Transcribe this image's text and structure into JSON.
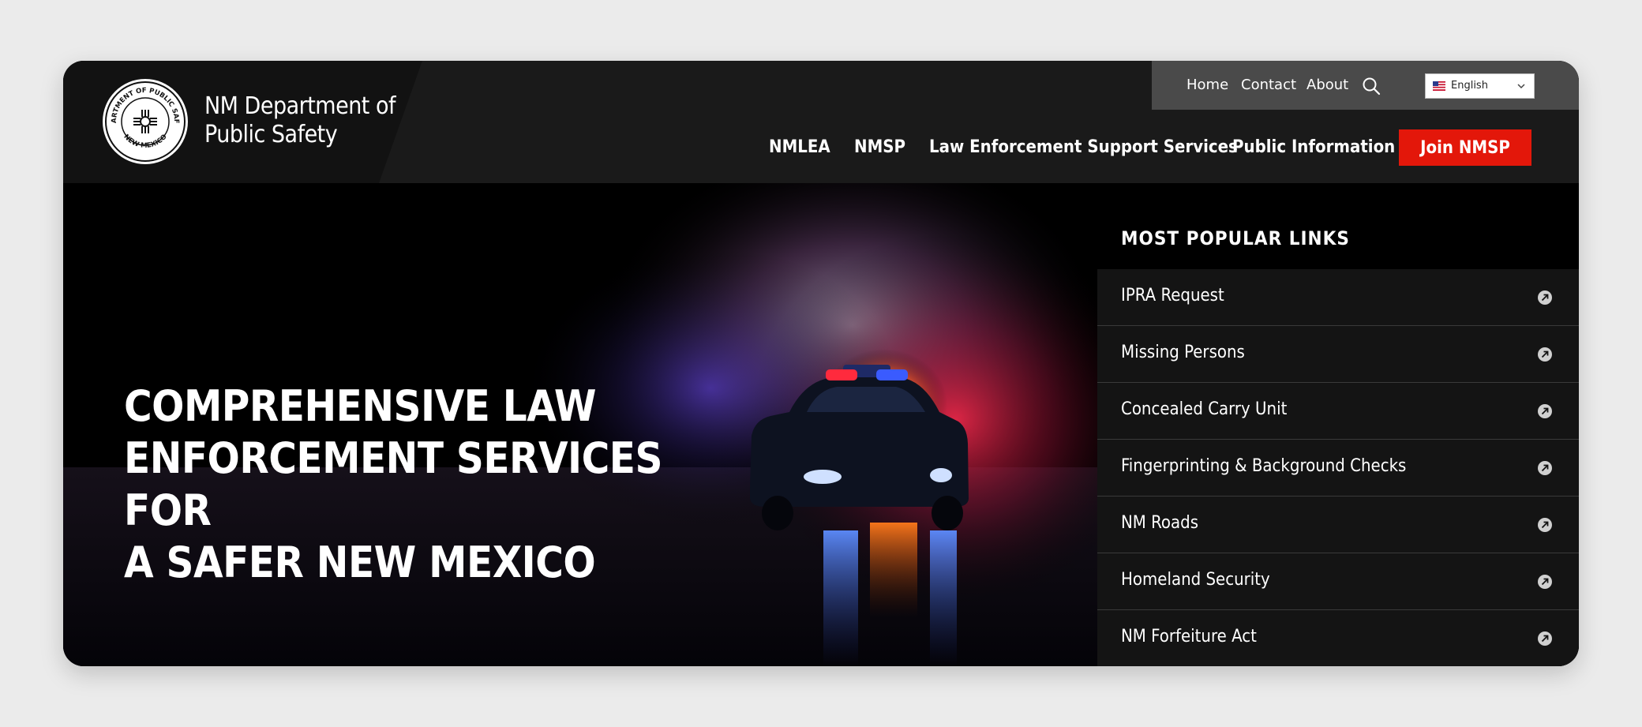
{
  "brand": {
    "seal_alt": "Department of Public Safety New Mexico seal",
    "seal_text_top": "DEPARTMENT OF PUBLIC SAFETY",
    "seal_text_bottom": "NEW MEXICO",
    "name_line1": "NM Department of",
    "name_line2": "Public Safety"
  },
  "utility_nav": {
    "links": [
      "Home",
      "Contact",
      "About"
    ],
    "search_icon": "search-icon",
    "language": {
      "selected": "English",
      "flag": "us-flag-icon"
    }
  },
  "main_nav": {
    "items": [
      "NMLEA",
      "NMSP",
      "Law Enforcement Support Services",
      "Public Information"
    ],
    "cta_label": "Join NMSP",
    "cta_color": "#e3170a"
  },
  "hero": {
    "headline_lines": [
      "COMPREHENSIVE LAW",
      "ENFORCEMENT SERVICES FOR",
      "A SAFER NEW MEXICO"
    ]
  },
  "popular_links": {
    "title": "MOST POPULAR LINKS",
    "items": [
      "IPRA Request",
      "Missing Persons",
      "Concealed Carry Unit",
      "Fingerprinting & Background Checks",
      "NM Roads",
      "Homeland Security",
      "NM Forfeiture Act"
    ],
    "item_icon": "external-arrow-icon"
  }
}
